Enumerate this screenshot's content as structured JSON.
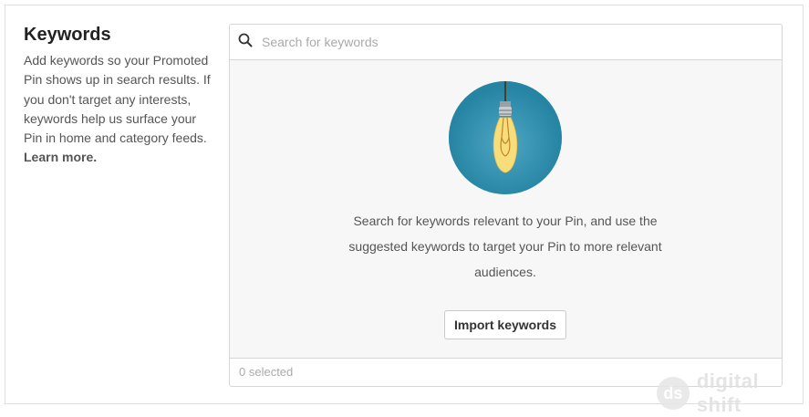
{
  "section": {
    "title": "Keywords",
    "description": "Add keywords so your Promoted Pin shows up in search results. If you don't target any interests, keywords help us surface your Pin in home and category feeds.",
    "learn_more": "Learn more."
  },
  "search": {
    "placeholder": "Search for keywords",
    "icon": "search-icon"
  },
  "empty_state": {
    "icon": "lightbulb-icon",
    "message": "Search for keywords relevant to your Pin, and use the suggested keywords to target your Pin to more relevant audiences.",
    "import_button": "Import keywords"
  },
  "footer": {
    "selected_text": "0 selected"
  },
  "watermark": {
    "logo_text": "ds",
    "text": "digital shift"
  },
  "colors": {
    "bulb_circle": "#2a8fb0",
    "bulb_glow": "#f4d35e",
    "panel_bg": "#f7f7f7"
  }
}
